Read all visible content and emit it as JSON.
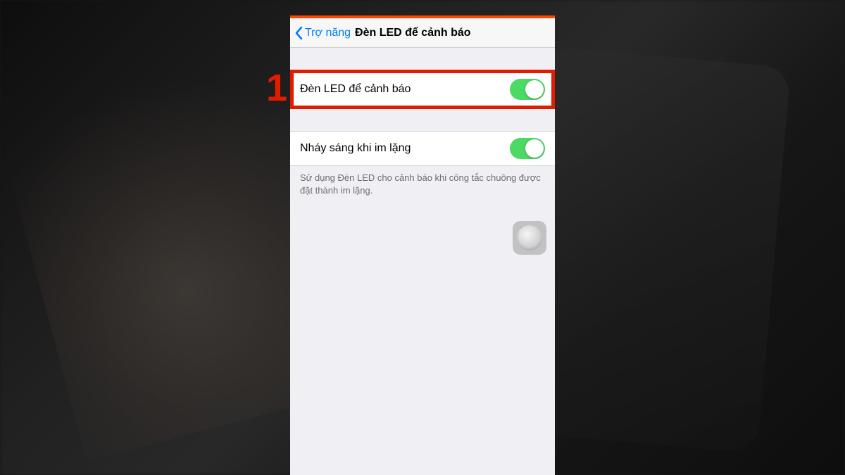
{
  "annotation": {
    "step_number": "1"
  },
  "nav": {
    "back_label": "Trợ năng",
    "title": "Đèn LED để cảnh báo"
  },
  "settings": {
    "group1": {
      "row1": {
        "label": "Đèn LED để cảnh báo",
        "enabled": true
      }
    },
    "group2": {
      "row1": {
        "label": "Nháy sáng khi im lặng",
        "enabled": true
      },
      "footer": "Sử dụng Đèn LED cho cảnh báo khi công tắc chuông được đặt thành im lặng."
    }
  },
  "colors": {
    "highlight": "#e31b00",
    "ios_blue": "#007aff",
    "toggle_green": "#4cd964",
    "top_bar": "#ff4500"
  }
}
